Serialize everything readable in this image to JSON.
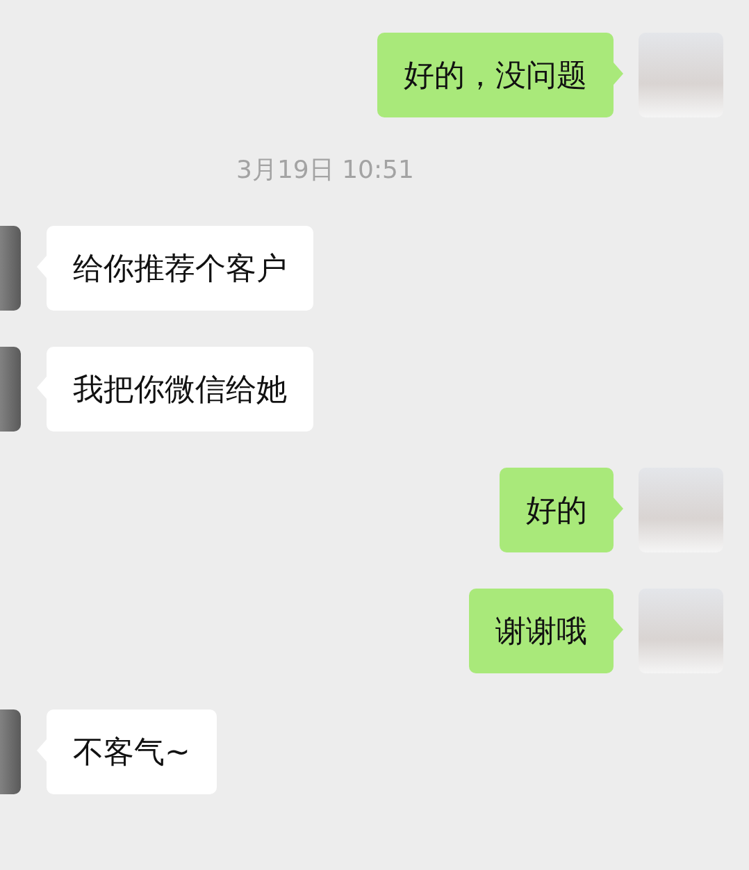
{
  "messages": [
    {
      "kind": "sent",
      "text": "好的，没问题"
    },
    {
      "kind": "timestamp",
      "text": "3月19日 10:51"
    },
    {
      "kind": "received",
      "text": "给你推荐个客户"
    },
    {
      "kind": "received",
      "text": "我把你微信给她"
    },
    {
      "kind": "sent",
      "text": "好的"
    },
    {
      "kind": "sent",
      "text": "谢谢哦"
    },
    {
      "kind": "received",
      "text": "不客气~"
    }
  ]
}
